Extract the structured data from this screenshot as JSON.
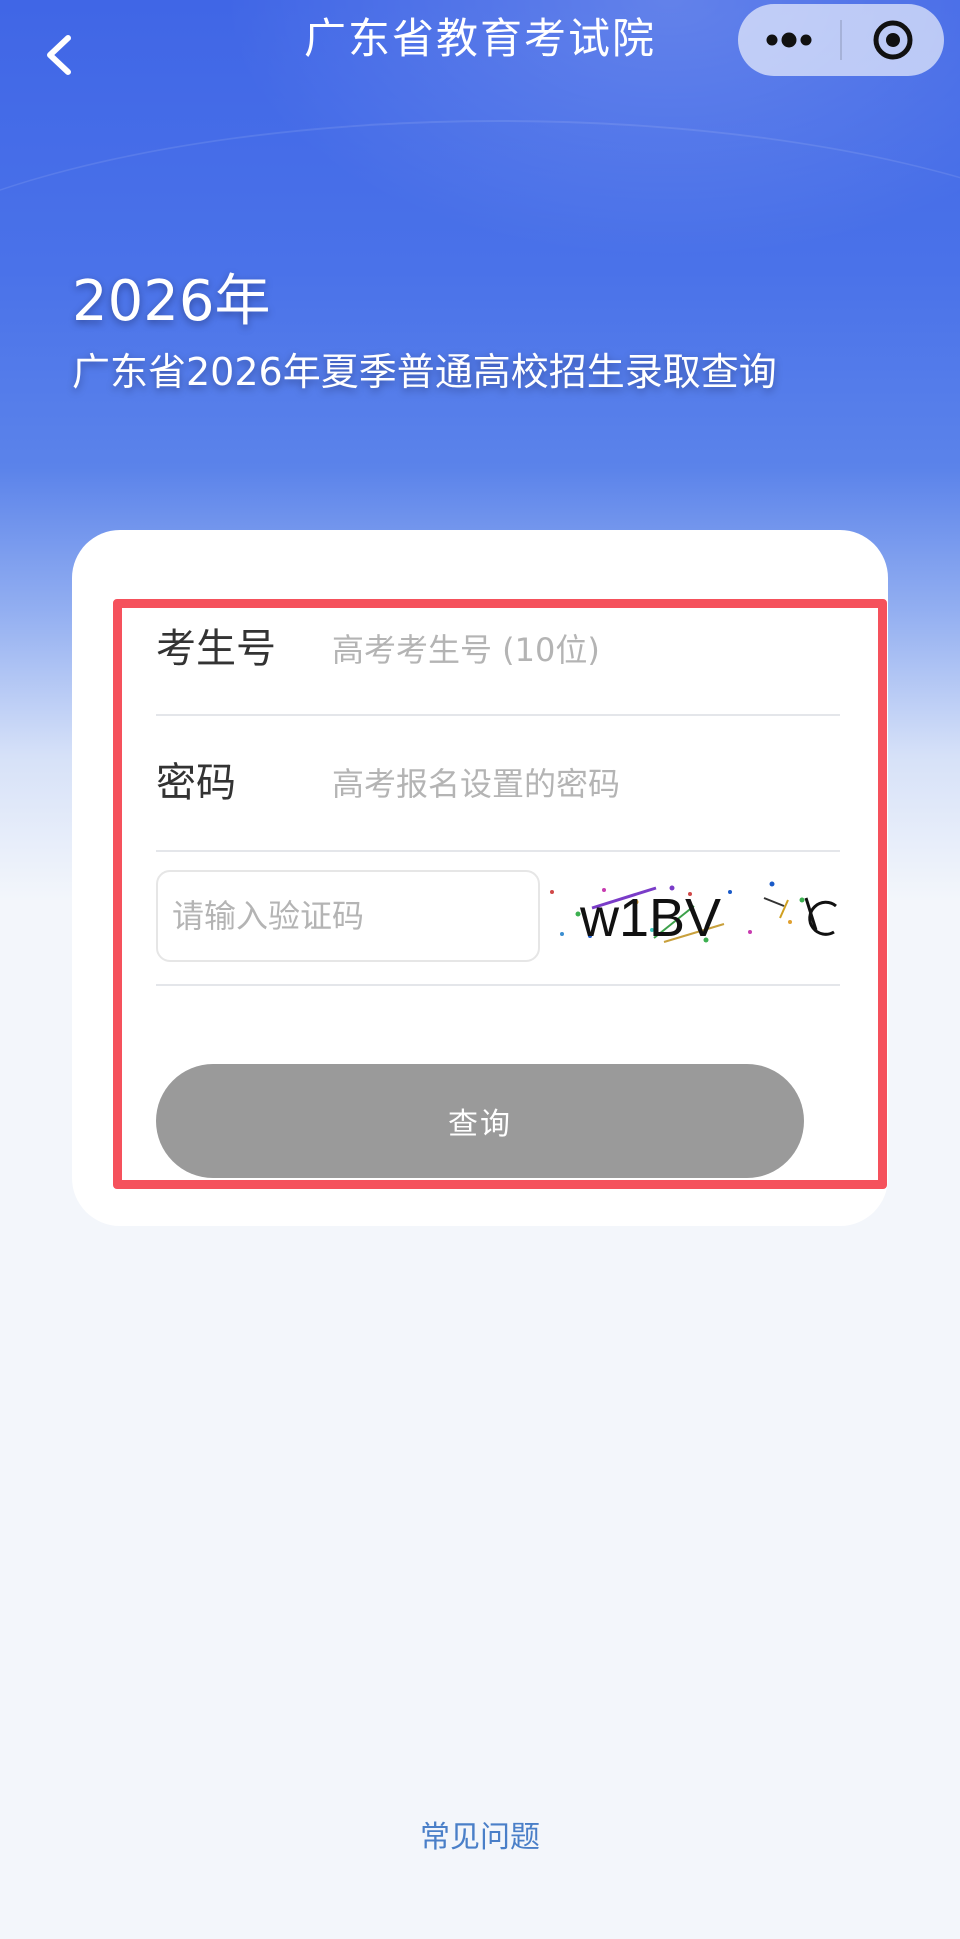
{
  "nav": {
    "title": "广东省教育考试院"
  },
  "hero": {
    "year": "2026年",
    "subtitle": "广东省2026年夏季普通高校招生录取查询"
  },
  "form": {
    "exam_number": {
      "label": "考生号",
      "placeholder": "高考考生号 (10位)",
      "value": ""
    },
    "password": {
      "label": "密码",
      "placeholder": "高考报名设置的密码",
      "value": ""
    },
    "captcha": {
      "placeholder": "请输入验证码",
      "value": "",
      "image_text": "w1BV"
    },
    "submit_label": "查询"
  },
  "footer": {
    "faq_label": "常见问题"
  },
  "colors": {
    "header_blue": "#4066e6",
    "highlight_red": "#f5515c",
    "button_gray": "#9a9a9a",
    "link_blue": "#4a7fc8"
  }
}
